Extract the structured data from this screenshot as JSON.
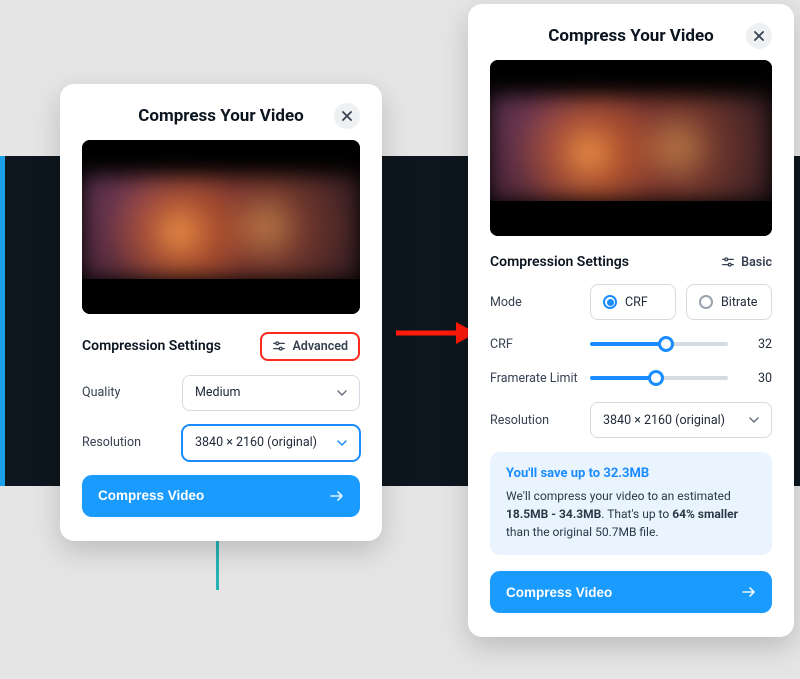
{
  "left": {
    "title": "Compress Your Video",
    "settings_title": "Compression Settings",
    "toggle_label": "Advanced",
    "quality_label": "Quality",
    "quality_value": "Medium",
    "resolution_label": "Resolution",
    "resolution_value": "3840 × 2160 (original)",
    "cta": "Compress Video"
  },
  "right": {
    "title": "Compress Your Video",
    "settings_title": "Compression Settings",
    "toggle_label": "Basic",
    "mode_label": "Mode",
    "mode_options": {
      "crf": "CRF",
      "bitrate": "Bitrate"
    },
    "crf_label": "CRF",
    "crf_value": "32",
    "crf_percent": 55,
    "fps_label": "Framerate Limit",
    "fps_value": "30",
    "fps_percent": 48,
    "resolution_label": "Resolution",
    "resolution_value": "3840 × 2160 (original)",
    "info_title": "You'll save up to 32.3MB",
    "info_prefix": "We'll compress your video to an estimated ",
    "info_range": "18.5MB - 34.3MB",
    "info_mid": ". That's up to ",
    "info_pct": "64% smaller",
    "info_suffix": " than the original 50.7MB file.",
    "cta": "Compress Video"
  }
}
